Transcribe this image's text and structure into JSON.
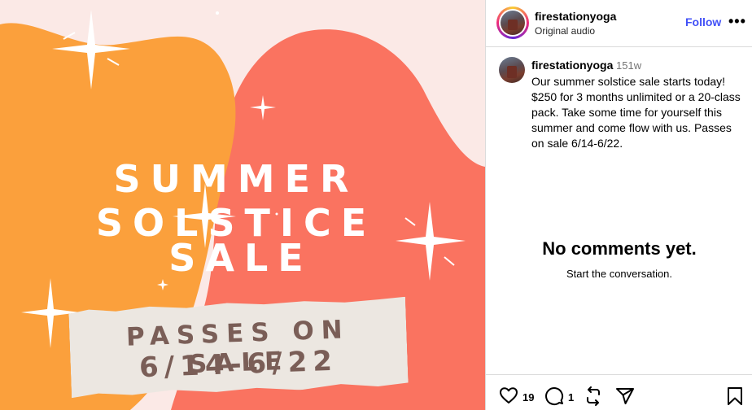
{
  "post_image": {
    "headline_line1": "SUMMER SOLSTICE",
    "headline_line2": "SALE",
    "paper_line1": "PASSES ON SALE",
    "paper_line2": "6/14-6/22"
  },
  "header": {
    "username": "firestationyoga",
    "audio": "Original audio",
    "follow_label": "Follow",
    "more_label": "•••"
  },
  "caption": {
    "username": "firestationyoga",
    "age": "151w",
    "text": "Our summer solstice sale starts today! $250 for 3 months unlimited or a 20-class pack. Take some time for yourself this summer and come flow with us. Passes on sale 6/14-6/22."
  },
  "comments": {
    "empty_title": "No comments yet.",
    "empty_subtitle": "Start the conversation."
  },
  "actions": {
    "like_count": "19",
    "comment_count": "1",
    "icons": [
      "heart-icon",
      "comment-icon",
      "repost-icon",
      "share-icon",
      "bookmark-icon"
    ]
  },
  "colors": {
    "orange_blob": "#fba03c",
    "coral_blob": "#fa7360",
    "background": "#fbe9e6",
    "follow": "#4150f7",
    "paper_text": "#7a5e57"
  }
}
